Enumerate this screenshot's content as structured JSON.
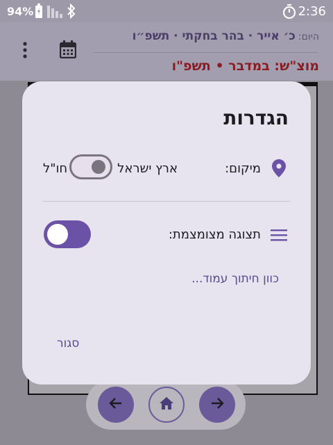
{
  "status_bar": {
    "battery_percent": "94%",
    "time": "2:36"
  },
  "header": {
    "today_label": "היום:",
    "today_value": "כ׳ אייר · בהר בחקתי · תשפ״ו",
    "motzash": "מוצ\"ש: במדבר • תשפ\"ו"
  },
  "dialog": {
    "title": "הגדרות",
    "location_label": "מיקום:",
    "location_option_israel": "ארץ ישראל",
    "location_option_abroad": "חו\"ל",
    "compact_label": "תצוגה מצומצמת:",
    "calibrate_link": "כוון חיתוך עמוד...",
    "close_button": "סגור"
  },
  "colors": {
    "accent": "#6b52a6",
    "motzash": "#8a1d22"
  },
  "icons": [
    "battery-icon",
    "signal-icon",
    "bluetooth-icon",
    "timer-icon",
    "more-vert-icon",
    "calendar-icon",
    "location-pin-icon",
    "menu-lines-icon",
    "arrow-left-icon",
    "home-icon",
    "arrow-right-icon"
  ]
}
